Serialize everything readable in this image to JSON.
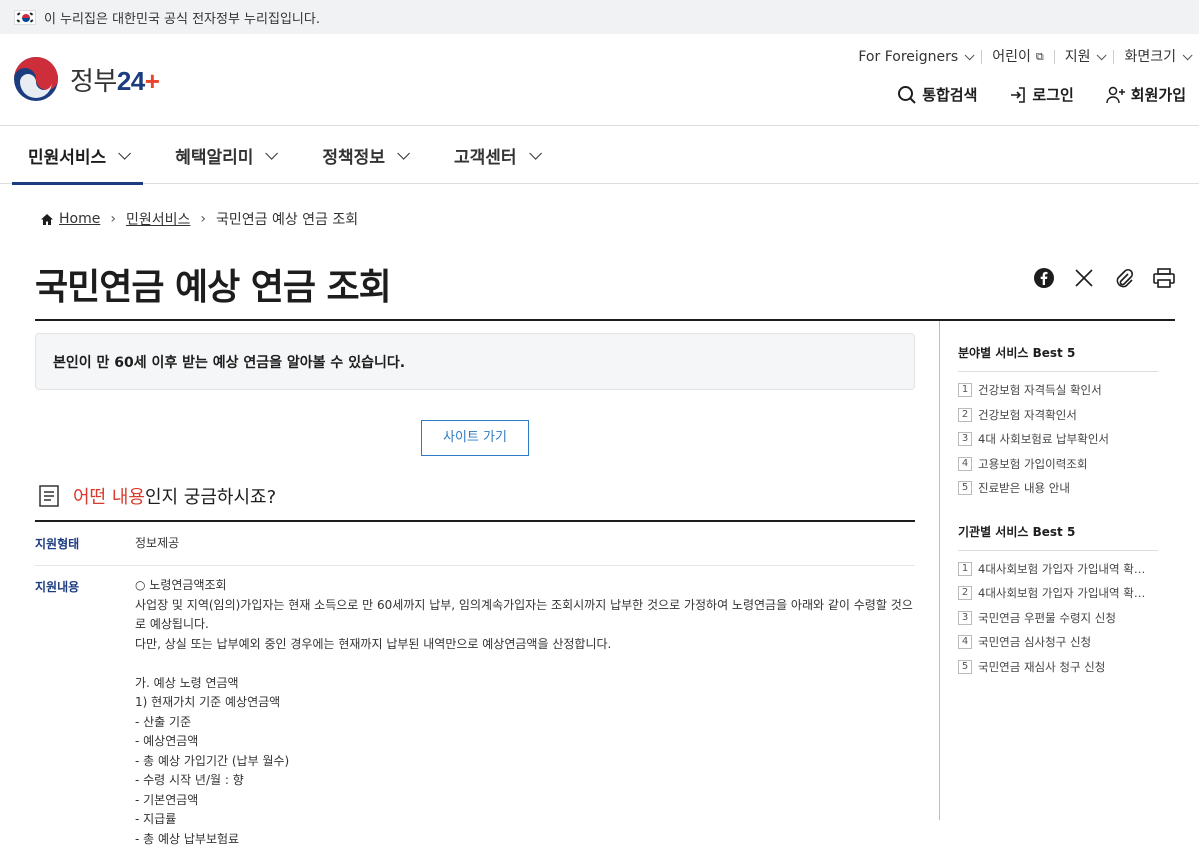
{
  "gov_banner": {
    "text": "이 누리집은 대한민국 공식 전자정부 누리집입니다."
  },
  "logo": {
    "text": "정부",
    "num": "24"
  },
  "util_menu": [
    {
      "label": "For Foreigners"
    },
    {
      "label": "어린이"
    },
    {
      "label": "지원"
    },
    {
      "label": "화면크기"
    }
  ],
  "actions": {
    "search": "통합검색",
    "login": "로그인",
    "signup": "회원가입"
  },
  "gnb": [
    {
      "label": "민원서비스"
    },
    {
      "label": "혜택알리미"
    },
    {
      "label": "정책정보"
    },
    {
      "label": "고객센터"
    }
  ],
  "breadcrumb": {
    "home": "Home",
    "level1": "민원서비스",
    "current": "국민연금 예상 연금 조회"
  },
  "page": {
    "title": "국민연금 예상 연금 조회",
    "summary": "본인이 만 60세 이후 받는 예상 연금을 알아볼 수 있습니다.",
    "site_button": "사이트 가기",
    "question": {
      "highlight": "어떤 내용",
      "rest": "인지 궁금하시죠?"
    },
    "info": [
      {
        "key": "지원형태",
        "value": "정보제공"
      },
      {
        "key": "지원내용",
        "lines": [
          "○ 노령연금액조회",
          "사업장 및 지역(임의)가입자는 현재 소득으로 만 60세까지 납부, 임의계속가입자는 조회시까지 납부한 것으로 가정하여 노령연금을 아래와 같이 수령할 것으로 예상됩니다.",
          "다만, 상실 또는 납부예외 중인 경우에는 현재까지 납부된 내역만으로 예상연금액을 산정합니다.",
          "",
          "가. 예상 노령 연금액",
          "1) 현재가치 기준 예상연금액",
          "- 산출 기준",
          "- 예상연금액",
          "- 총 예상 가입기간 (납부 월수)",
          "- 수령 시작 년/월 : 향",
          "- 기본연금액",
          "- 지급률",
          "- 총 예상 납부보험료"
        ]
      }
    ]
  },
  "sidebar": {
    "field_title": "분야별 서비스 Best 5",
    "field_items": [
      {
        "n": "1",
        "label": "건강보험 자격득실 확인서"
      },
      {
        "n": "2",
        "label": "건강보험 자격확인서"
      },
      {
        "n": "3",
        "label": "4대 사회보험료 납부확인서"
      },
      {
        "n": "4",
        "label": "고용보험 가입이력조회"
      },
      {
        "n": "5",
        "label": "진료받은 내용 안내"
      }
    ],
    "agency_title": "기관별 서비스 Best 5",
    "agency_items": [
      {
        "n": "1",
        "label": "4대사회보험 가입자 가입내역 확…"
      },
      {
        "n": "2",
        "label": "4대사회보험 가입자 가입내역 확…"
      },
      {
        "n": "3",
        "label": "국민연금 우편물 수령지 신청"
      },
      {
        "n": "4",
        "label": "국민연금 심사청구 신청"
      },
      {
        "n": "5",
        "label": "국민연금 재심사 청구 신청"
      }
    ]
  },
  "colors": {
    "accent": "#1c3c80",
    "highlight": "#d93a2c",
    "link_button": "#2e7bc4"
  }
}
